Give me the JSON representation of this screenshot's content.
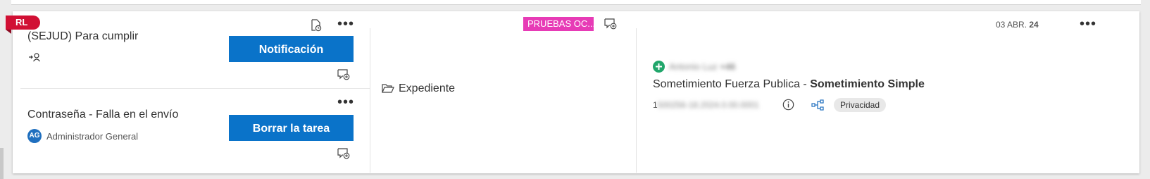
{
  "card": {
    "initials_badge": "RL",
    "date": {
      "day_month": "03 ABR.",
      "year": "24"
    },
    "more_symbol": "•••",
    "tasks": [
      {
        "title": "(SEJUD) Para cumplir",
        "assignee_icon": "assign-user-icon",
        "action_label": "Notificación"
      },
      {
        "title": "Contraseña - Falla en el envío",
        "assignee_initials": "AG",
        "assignee_name": "Administrador General",
        "action_label": "Borrar la tarea"
      }
    ],
    "middle": {
      "tag": "PRUEBAS OC...",
      "folder_label": "Expediente"
    },
    "case": {
      "person_name": "Antonio Luz",
      "person_extra": "+46",
      "title_prefix": "Sometimiento Fuerza Publica - ",
      "title_bold": "Sometimiento Simple",
      "number_visible": "1",
      "number_blurred": "500256-18.2024.0.00.0001",
      "privacy_label": "Privacidad"
    }
  },
  "colors": {
    "accent_blue": "#0a73c9",
    "badge_red": "#d11034",
    "tag_pink": "#e73bb6",
    "add_green": "#21a66b"
  }
}
